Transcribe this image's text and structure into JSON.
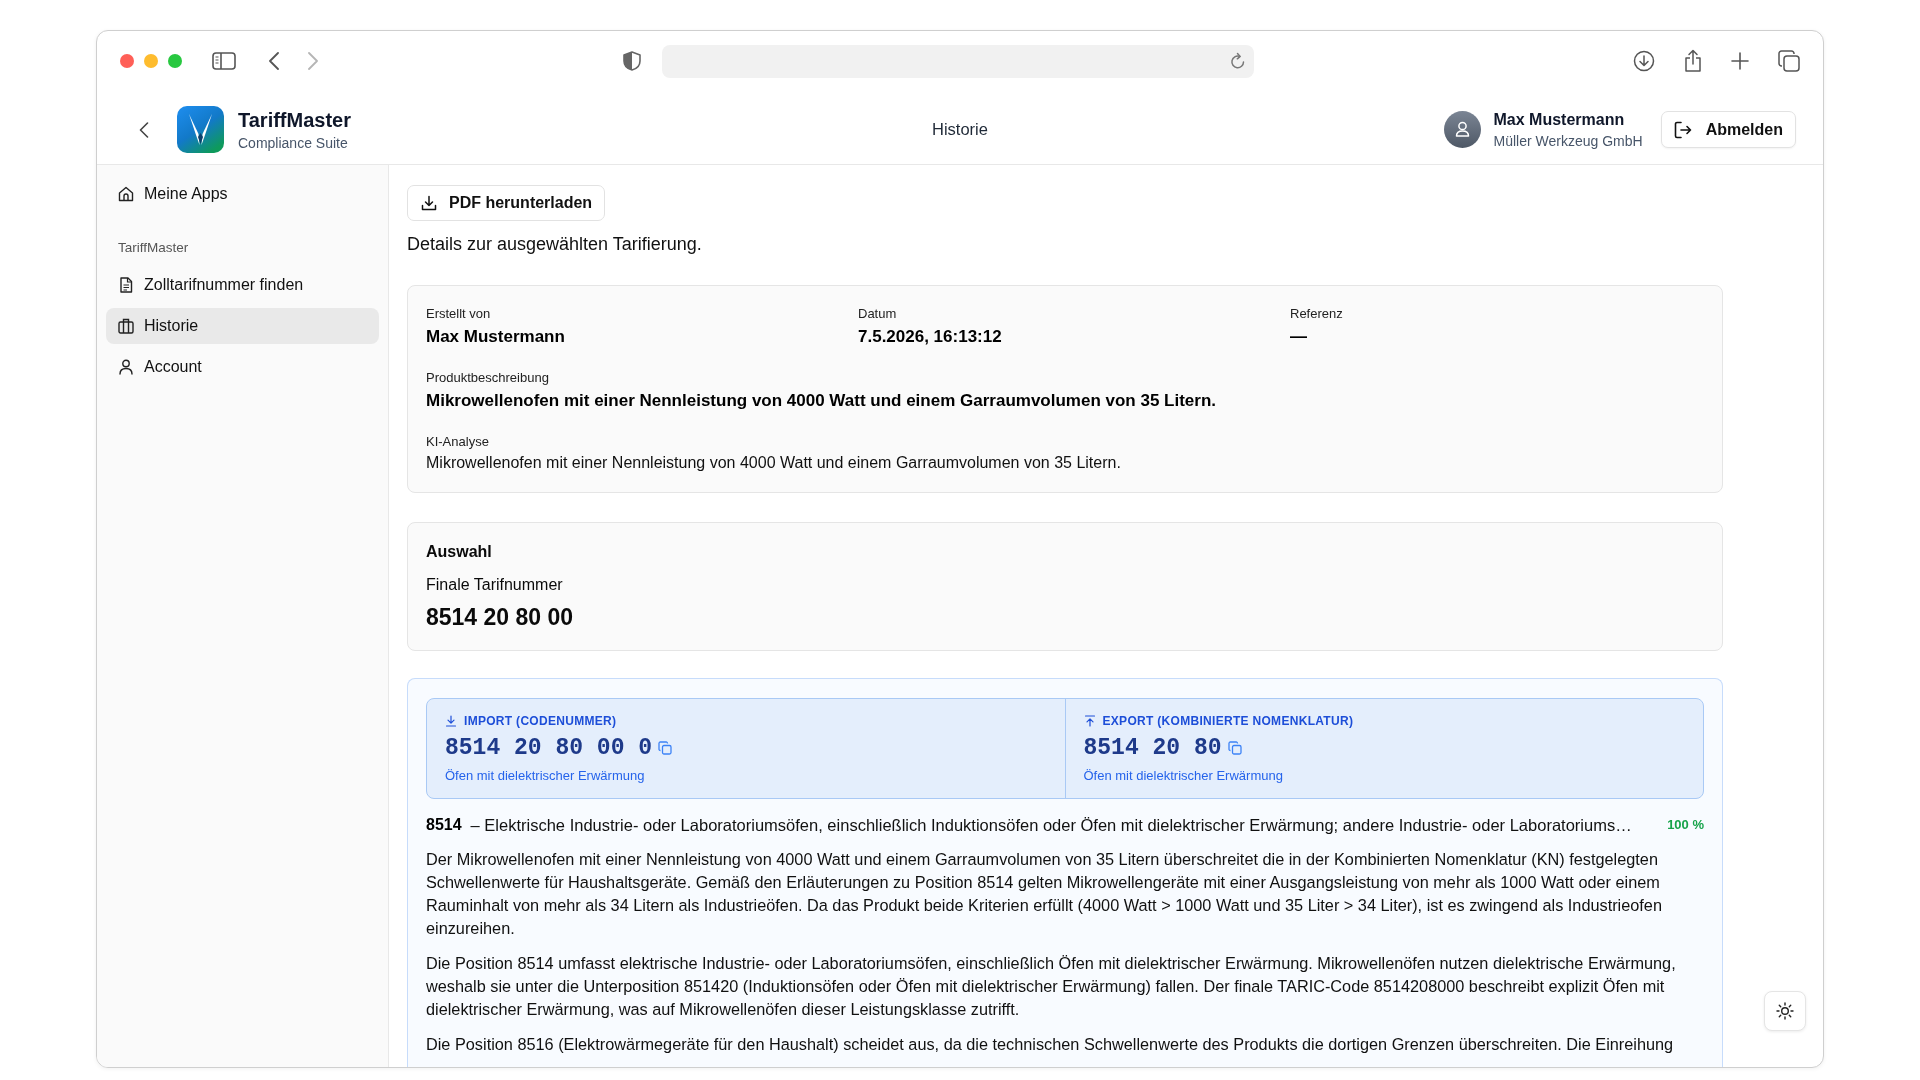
{
  "header": {
    "app_name": "TariffMaster",
    "app_subtitle": "Compliance Suite",
    "page_title": "Historie",
    "user_name": "Max Mustermann",
    "user_company": "Müller Werkzeug GmbH",
    "logout_button": "Abmelden"
  },
  "sidebar": {
    "items": [
      {
        "label": "Meine Apps",
        "selected": false
      }
    ],
    "section_label": "TariffMaster",
    "section_items": [
      {
        "label": "Zolltarifnummer finden",
        "selected": false
      },
      {
        "label": "Historie",
        "selected": true
      },
      {
        "label": "Account",
        "selected": false
      }
    ]
  },
  "toolbar": {
    "pdf_button": "PDF herunterladen"
  },
  "intro": "Details zur ausgewählten Tarifierung.",
  "details": {
    "fields": [
      {
        "label": "Erstellt von",
        "value": "Max Mustermann"
      },
      {
        "label": "Datum",
        "value": "7.5.2026, 16:13:12"
      },
      {
        "label": "Referenz",
        "value": "—"
      }
    ],
    "description": {
      "label": "Produktbeschreibung",
      "value": "Mikrowellenofen mit einer Nennleistung von 4000 Watt und einem Garraumvolumen von 35 Litern."
    },
    "analysis": {
      "label": "KI-Analyse",
      "value": "Mikrowellenofen mit einer Nennleistung von 4000 Watt und einem Garraumvolumen von 35 Litern."
    }
  },
  "selection": {
    "title": "Auswahl",
    "label": "Finale Tarifnummer",
    "value": "8514 20 80 00"
  },
  "classification": {
    "codes": [
      {
        "kind": "import",
        "label": "IMPORT (CODENUMMER)",
        "code": "8514 20 80 00 0",
        "description": "Öfen mit dielektrischer Erwärmung"
      },
      {
        "kind": "export",
        "label": "EXPORT (KOMBINIERTE NOMENKLATUR)",
        "code": "8514 20 80",
        "description": "Öfen mit dielektrischer Erwärmung"
      }
    ],
    "heading": {
      "number": "8514",
      "text": "– Elektrische Industrie- oder Laboratoriumsöfen, einschließlich Induktionsöfen oder Öfen mit dielektrischer Erwärmung; andere Industrie- oder Laboratoriums…",
      "confidence": "100 %"
    },
    "paragraphs": [
      "Der Mikrowellenofen mit einer Nennleistung von 4000 Watt und einem Garraumvolumen von 35 Litern überschreitet die in der Kombinierten Nomenklatur (KN) festgelegten Schwellenwerte für Haushaltsgeräte. Gemäß den Erläuterungen zu Position 8514 gelten Mikrowellengeräte mit einer Ausgangsleistung von mehr als 1000 Watt oder einem Rauminhalt von mehr als 34 Litern als Industrieöfen. Da das Produkt beide Kriterien erfüllt (4000 Watt > 1000 Watt und 35 Liter > 34 Liter), ist es zwingend als Industrieofen einzureihen.",
      "Die Position 8514 umfasst elektrische Industrie- oder Laboratoriumsöfen, einschließlich Öfen mit dielektrischer Erwärmung. Mikrowellenöfen nutzen dielektrische Erwärmung, weshalb sie unter die Unterposition 851420 (Induktionsöfen oder Öfen mit dielektrischer Erwärmung) fallen. Der finale TARIC-Code 8514208000 beschreibt explizit Öfen mit dielektrischer Erwärmung, was auf Mikrowellenöfen dieser Leistungsklasse zutrifft.",
      "Die Position 8516 (Elektrowärmegeräte für den Haushalt) scheidet aus, da die technischen Schwellenwerte des Produkts die dortigen Grenzen überschreiten. Die Einreihung"
    ]
  }
}
